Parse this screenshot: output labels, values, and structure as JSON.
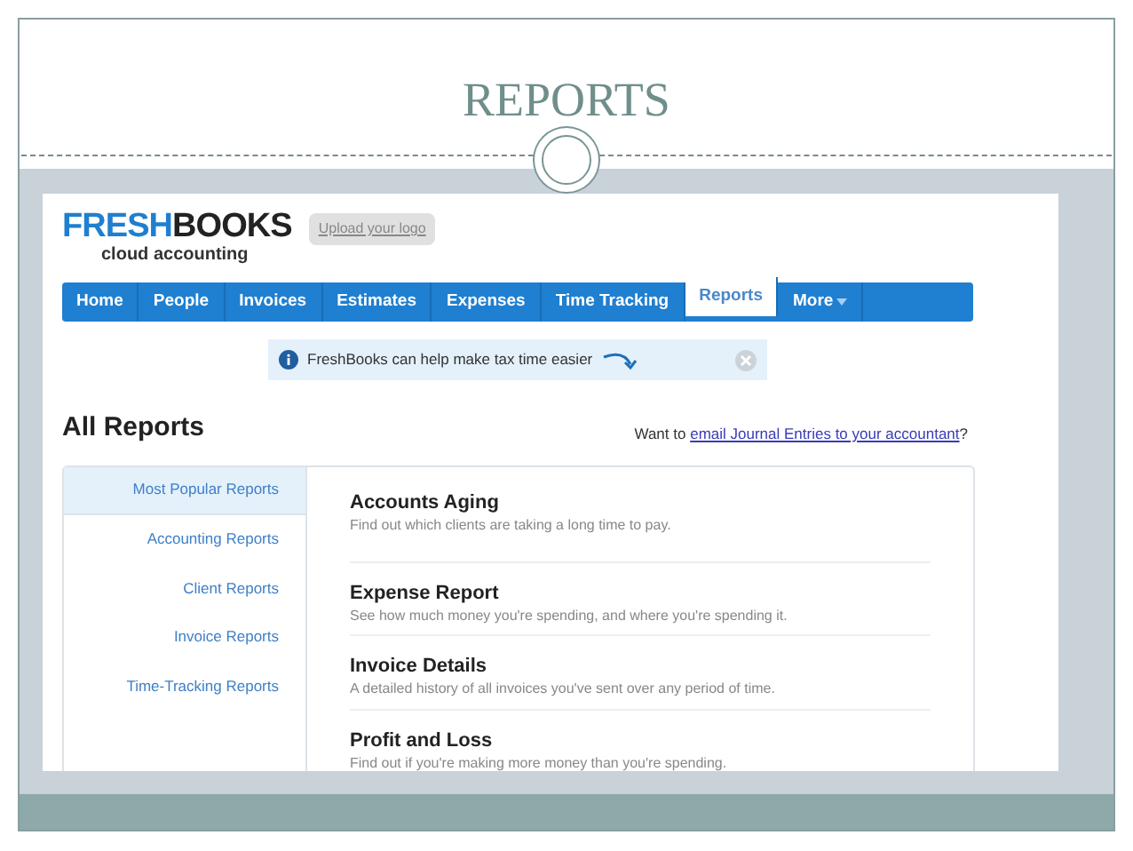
{
  "slide": {
    "title": "REPORTS"
  },
  "logo": {
    "first": "FRESH",
    "second": "BOOKS",
    "tagline": "cloud accounting"
  },
  "upload_logo": "Upload your logo",
  "nav": [
    {
      "label": "Home",
      "selected": false,
      "dropdown": false
    },
    {
      "label": "People",
      "selected": false,
      "dropdown": false
    },
    {
      "label": "Invoices",
      "selected": false,
      "dropdown": false
    },
    {
      "label": "Estimates",
      "selected": false,
      "dropdown": false
    },
    {
      "label": "Expenses",
      "selected": false,
      "dropdown": false
    },
    {
      "label": "Time Tracking",
      "selected": false,
      "dropdown": false
    },
    {
      "label": "Reports",
      "selected": true,
      "dropdown": false
    },
    {
      "label": "More",
      "selected": false,
      "dropdown": true
    }
  ],
  "banner": {
    "text": "FreshBooks can help make tax time easier"
  },
  "heading": "All Reports",
  "email_prompt": {
    "before": "Want to ",
    "link": "email Journal Entries to your accountant",
    "after": "?"
  },
  "sidebar": [
    {
      "label": "Most Popular Reports",
      "selected": true
    },
    {
      "label": "Accounting Reports",
      "selected": false
    },
    {
      "label": "Client Reports",
      "selected": false
    },
    {
      "label": "Invoice Reports",
      "selected": false
    },
    {
      "label": "Time-Tracking Reports",
      "selected": false
    }
  ],
  "reports": [
    {
      "title": "Accounts Aging",
      "description": "Find out which clients are taking a long time to pay."
    },
    {
      "title": "Expense Report",
      "description": "See how much money you're spending, and where you're spending it."
    },
    {
      "title": "Invoice Details",
      "description": "A detailed history of all invoices you've sent over any period of time."
    },
    {
      "title": "Profit and Loss",
      "description": "Find out if you're making more money than you're spending."
    }
  ]
}
